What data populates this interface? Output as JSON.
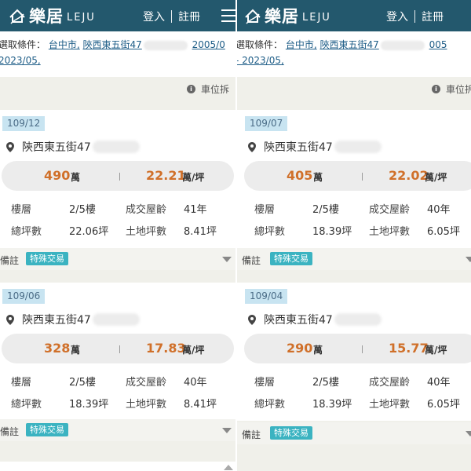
{
  "header": {
    "brand": "樂居",
    "brand_sub": "LEJU",
    "login": "登入",
    "register": "註冊",
    "logo_icon": "house-logo-icon",
    "menu_icon": "hamburger-menu-icon"
  },
  "colors": {
    "header_bg": "#23586d",
    "accent_orange": "#d0702a",
    "link_blue": "#1e5d87",
    "badge_teal": "#3bb3c1",
    "date_tag_bg": "#c8e4f1"
  },
  "left": {
    "filter": {
      "label": "選取條件：",
      "city": "台中市,",
      "street": "陝西東五街47",
      "date_start": "2005/0",
      "date_end": "2023/05,"
    },
    "info_label": "車位拆",
    "cards": [
      {
        "date": "109/12",
        "address": "陝西東五街47",
        "total_price": "490",
        "total_unit": "萬",
        "unit_price": "22.21",
        "unit_price_unit": "萬/坪",
        "floor_label": "樓層",
        "floor": "2/5樓",
        "age_label": "成交屋齡",
        "age": "41年",
        "area_label": "總坪數",
        "area": "22.06坪",
        "land_label": "土地坪數",
        "land": "8.41坪",
        "note_label": "備註",
        "note_badge": "特殊交易"
      },
      {
        "date": "109/06",
        "address": "陝西東五街47",
        "total_price": "328",
        "total_unit": "萬",
        "unit_price": "17.83",
        "unit_price_unit": "萬/坪",
        "floor_label": "樓層",
        "floor": "2/5樓",
        "age_label": "成交屋齡",
        "age": "40年",
        "area_label": "總坪數",
        "area": "18.39坪",
        "land_label": "土地坪數",
        "land": "8.41坪",
        "note_label": "備註",
        "note_badge": "特殊交易"
      }
    ]
  },
  "right": {
    "filter": {
      "label": "選取條件：",
      "city": "台中市,",
      "street": "陝西東五街47",
      "date_start": "005",
      "date_end": "- 2023/05,"
    },
    "info_label": "車位拆",
    "cards": [
      {
        "date": "109/07",
        "address": "陝西東五街47",
        "total_price": "405",
        "total_unit": "萬",
        "unit_price": "22.02",
        "unit_price_unit": "萬/坪",
        "floor_label": "樓層",
        "floor": "2/5樓",
        "age_label": "成交屋齡",
        "age": "40年",
        "area_label": "總坪數",
        "area": "18.39坪",
        "land_label": "土地坪數",
        "land": "6.05坪",
        "note_label": "備註",
        "note_badge": "特殊交易"
      },
      {
        "date": "109/04",
        "address": "陝西東五街47",
        "total_price": "290",
        "total_unit": "萬",
        "unit_price": "15.77",
        "unit_price_unit": "萬/坪",
        "floor_label": "樓層",
        "floor": "2/5樓",
        "age_label": "成交屋齡",
        "age": "40年",
        "area_label": "總坪數",
        "area": "18.39坪",
        "land_label": "土地坪數",
        "land": "6.05坪",
        "note_label": "備註",
        "note_badge": "特殊交易"
      }
    ]
  }
}
